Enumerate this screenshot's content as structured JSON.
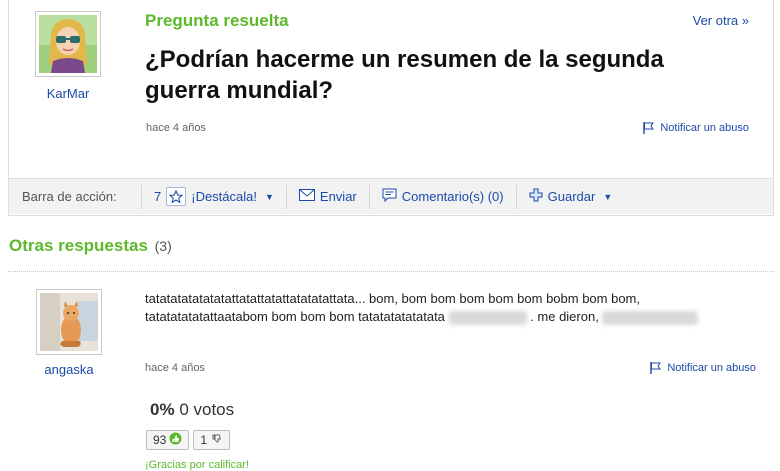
{
  "question": {
    "status_label": "Pregunta resuelta",
    "see_other": "Ver otra »",
    "title": "¿Podrían hacerme un resumen de la segunda guerra mundial?",
    "author": "KarMar",
    "time": "hace 4 años",
    "report": "Notificar un abuso"
  },
  "action_bar": {
    "label": "Barra de acción:",
    "star_count": "7",
    "highlight": "¡Destácala!",
    "send": "Enviar",
    "comments": "Comentario(s) (0)",
    "save": "Guardar"
  },
  "answers": {
    "heading": "Otras respuestas",
    "count": "(3)",
    "items": [
      {
        "author": "angaska",
        "text_part1": "tatatatatatatatattatattatattatatatattata... bom, bom bom bom bom bom bobm bom bom, tatatatatatattaatabom bom bom bom tatatatatatatata",
        "text_part2": ". me dieron,",
        "time": "hace 4 años",
        "report": "Notificar un abuso",
        "vote_percent": "0%",
        "vote_label": "0 votos",
        "thumbs_up": "93",
        "thumbs_down": "1",
        "thanks": "¡Gracias por calificar!"
      }
    ]
  },
  "colors": {
    "accent_green": "#5db82b",
    "link_blue": "#1b4aa8"
  }
}
